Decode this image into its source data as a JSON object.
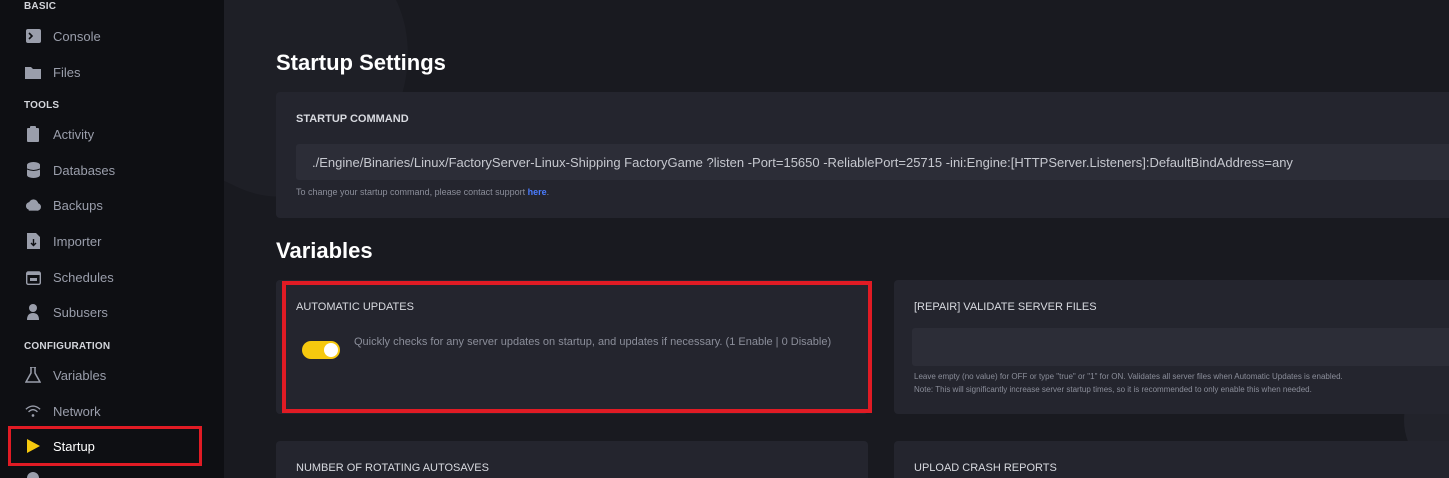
{
  "sidebar": {
    "sections": [
      "BASIC",
      "TOOLS",
      "CONFIGURATION"
    ],
    "items": [
      {
        "label": "Console",
        "icon": "terminal-icon"
      },
      {
        "label": "Files",
        "icon": "folder-icon"
      },
      {
        "label": "Activity",
        "icon": "clipboard-icon"
      },
      {
        "label": "Databases",
        "icon": "database-icon"
      },
      {
        "label": "Backups",
        "icon": "cloud-icon"
      },
      {
        "label": "Importer",
        "icon": "file-import-icon"
      },
      {
        "label": "Schedules",
        "icon": "calendar-icon"
      },
      {
        "label": "Subusers",
        "icon": "user-icon"
      },
      {
        "label": "Variables",
        "icon": "flask-icon"
      },
      {
        "label": "Network",
        "icon": "wifi-icon"
      },
      {
        "label": "Startup",
        "icon": "play-icon"
      }
    ],
    "active": "Startup"
  },
  "startup": {
    "title": "Startup Settings",
    "command_label": "STARTUP COMMAND",
    "command": "./Engine/Binaries/Linux/FactoryServer-Linux-Shipping FactoryGame ?listen -Port=15650 -ReliablePort=25715 -ini:Engine:[HTTPServer.Listeners]:DefaultBindAddress=any",
    "hint_prefix": "To change your startup command, please contact support ",
    "hint_link": "here",
    "hint_suffix": "."
  },
  "variables": {
    "title": "Variables",
    "items": [
      {
        "label": "AUTOMATIC UPDATES",
        "description": "Quickly checks for any server updates on startup, and updates if necessary. (1 Enable | 0 Disable)",
        "toggle_on": true
      },
      {
        "label": "[REPAIR] VALIDATE SERVER FILES",
        "value": "",
        "description_line1": "Leave empty (no value) for OFF or type \"true\" or \"1\" for ON. Validates all server files when Automatic Updates is enabled.",
        "description_line2": "Note: This will significantly increase server startup times, so it is recommended to only enable this when needed."
      },
      {
        "label": "NUMBER OF ROTATING AUTOSAVES"
      },
      {
        "label": "UPLOAD CRASH REPORTS"
      }
    ]
  },
  "colors": {
    "accent": "#f6c90e",
    "highlight": "#e01b24",
    "link": "#4a7cff"
  }
}
